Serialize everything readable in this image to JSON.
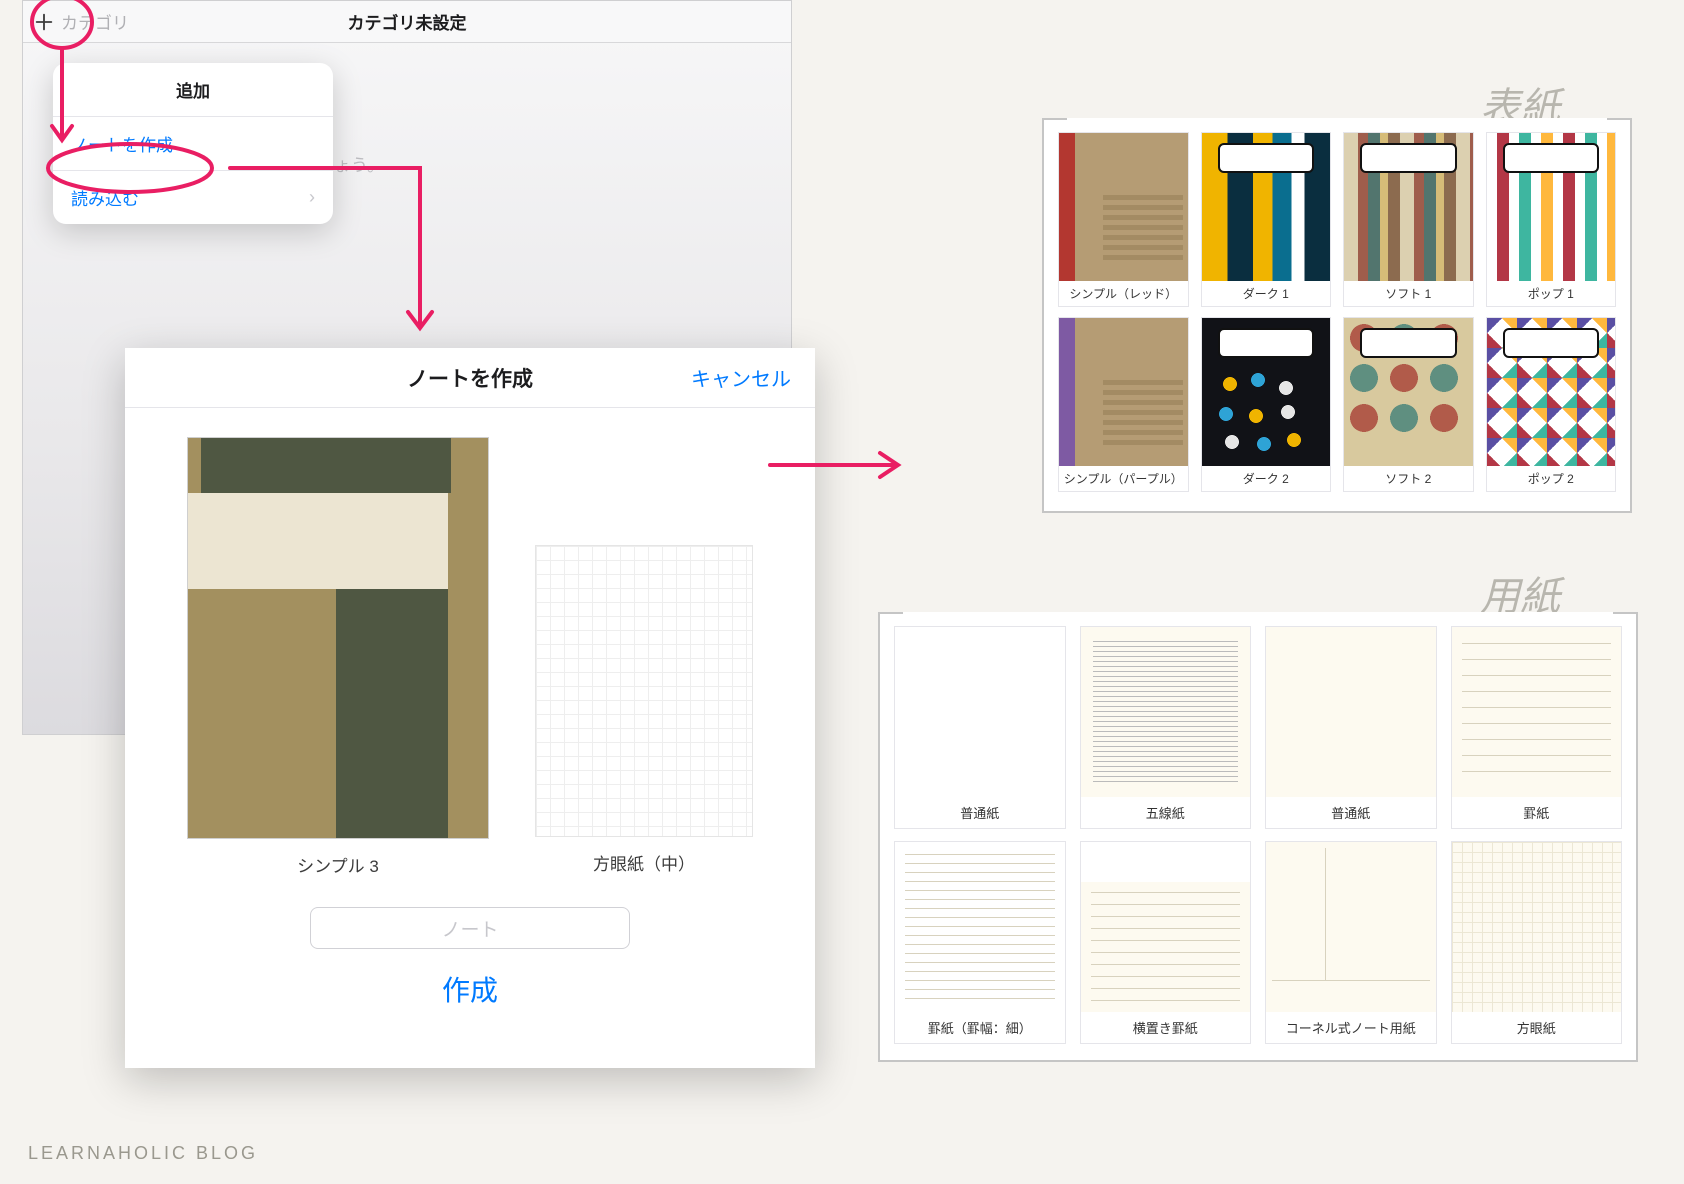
{
  "watermark": "LEARNAHOLIC BLOG",
  "ipad": {
    "cat_label": "カテゴリ",
    "title": "カテゴリ未設定",
    "body_hint": "しましょう。",
    "popover": {
      "header": "追加",
      "create_note": "ノートを作成",
      "import": "読み込む"
    }
  },
  "modal": {
    "title": "ノートを作成",
    "cancel": "キャンセル",
    "cover_name": "シンプル 3",
    "paper_name": "方眼紙（中）",
    "input_placeholder": "ノート",
    "create": "作成"
  },
  "section_labels": {
    "covers": "表紙",
    "papers": "用紙"
  },
  "covers": [
    {
      "name": "シンプル（レッド）"
    },
    {
      "name": "ダーク 1"
    },
    {
      "name": "ソフト 1"
    },
    {
      "name": "ポップ 1"
    },
    {
      "name": "シンプル（パープル）"
    },
    {
      "name": "ダーク 2"
    },
    {
      "name": "ソフト 2"
    },
    {
      "name": "ポップ 2"
    }
  ],
  "papers": [
    {
      "name": "普通紙"
    },
    {
      "name": "五線紙"
    },
    {
      "name": "普通紙"
    },
    {
      "name": "罫紙"
    },
    {
      "name": "罫紙（罫幅：細）"
    },
    {
      "name": "横置き罫紙"
    },
    {
      "name": "コーネル式ノート用紙"
    },
    {
      "name": "方眼紙"
    }
  ]
}
